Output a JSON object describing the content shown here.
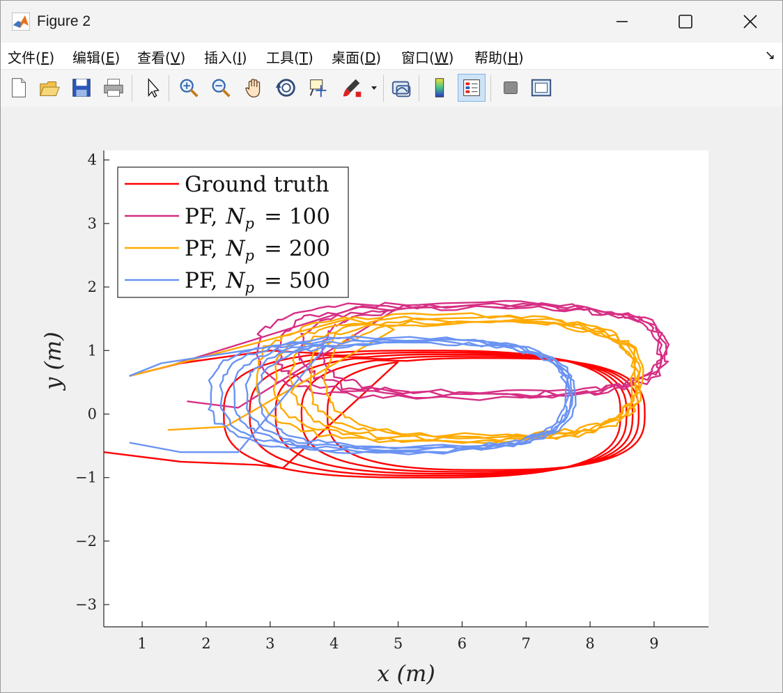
{
  "window": {
    "title": "Figure 2"
  },
  "menu": [
    {
      "pre": "文件(",
      "key": "F",
      "post": ")"
    },
    {
      "pre": "编辑(",
      "key": "E",
      "post": ")"
    },
    {
      "pre": "查看(",
      "key": "V",
      "post": ")"
    },
    {
      "pre": "插入(",
      "key": "I",
      "post": ")"
    },
    {
      "pre": "工具(",
      "key": "T",
      "post": ")"
    },
    {
      "pre": "桌面(",
      "key": "D",
      "post": ")"
    },
    {
      "pre": "窗口(",
      "key": "W",
      "post": ")"
    },
    {
      "pre": "帮助(",
      "key": "H",
      "post": ")"
    }
  ],
  "toolbar": {
    "icons": [
      "new-file-icon",
      "open-folder-icon",
      "save-icon",
      "print-icon",
      "pointer-icon",
      "zoom-in-icon",
      "zoom-out-icon",
      "pan-hand-icon",
      "rotate-3d-icon",
      "data-tips-icon",
      "brush-icon",
      "link-plot-icon",
      "colorbar-icon",
      "legend-icon",
      "hide-plot-tools-icon",
      "show-plot-tools-icon"
    ],
    "active": "legend-icon"
  },
  "chart_data": {
    "type": "line",
    "xlabel": "x (m)",
    "ylabel": "y (m)",
    "xlim": [
      0.4,
      9.85
    ],
    "ylim": [
      -3.35,
      4.15
    ],
    "xticks": [
      1,
      2,
      3,
      4,
      5,
      6,
      7,
      8,
      9
    ],
    "yticks": [
      -3,
      -2,
      -1,
      0,
      1,
      2,
      3,
      4
    ],
    "xtick_labels": [
      "1",
      "2",
      "3",
      "4",
      "5",
      "6",
      "7",
      "8",
      "9"
    ],
    "ytick_labels": [
      "−3",
      "−2",
      "−1",
      "0",
      "1",
      "2",
      "3",
      "4"
    ],
    "grid": false,
    "legend": {
      "position": "top-left",
      "entries": [
        {
          "label_main": "Ground truth",
          "label_var": "",
          "label_sub": "",
          "label_val": ""
        },
        {
          "label_main": "PF,",
          "label_var": "N",
          "label_sub": "p",
          "label_val": "= 100"
        },
        {
          "label_main": "PF,",
          "label_var": "N",
          "label_sub": "p",
          "label_val": "= 200"
        },
        {
          "label_main": "PF,",
          "label_var": "N",
          "label_sub": "p",
          "label_val": "= 500"
        }
      ]
    },
    "series": [
      {
        "name": "Ground truth",
        "color": "#ff0000",
        "loops": {
          "cx": 6.0,
          "cy": 0.0,
          "rx": 3.1,
          "ry": 1.0,
          "n": 5,
          "shift": 0.25,
          "shrink": 0.05,
          "noise": 0.0
        },
        "lead": [
          [
            0.4,
            -0.6
          ],
          [
            1.6,
            -0.75
          ],
          [
            2.8,
            -0.8
          ],
          [
            3.2,
            -0.85
          ]
        ],
        "start": [
          [
            0.8,
            0.6
          ],
          [
            1.6,
            0.8
          ],
          [
            3.0,
            1.0
          ]
        ]
      },
      {
        "name": "PF, Np = 100",
        "color": "#d62f84",
        "loops": {
          "cx": 6.3,
          "cy": 1.0,
          "rx": 3.2,
          "ry": 0.75,
          "n": 4,
          "shift": 0.15,
          "shrink": 0.06,
          "noise": 0.05
        },
        "lead": [
          [
            1.7,
            0.2
          ],
          [
            2.5,
            0.1
          ]
        ],
        "start": [
          [
            0.8,
            0.6
          ],
          [
            1.4,
            0.75
          ]
        ]
      },
      {
        "name": "PF, Np = 200",
        "color": "#ffaa00",
        "loops": {
          "cx": 6.1,
          "cy": 0.55,
          "rx": 3.0,
          "ry": 1.0,
          "n": 5,
          "shift": 0.12,
          "shrink": 0.05,
          "noise": 0.045
        },
        "lead": [
          [
            1.4,
            -0.25
          ],
          [
            2.3,
            -0.2
          ]
        ],
        "start": [
          [
            0.8,
            0.6
          ],
          [
            1.2,
            0.7
          ]
        ]
      },
      {
        "name": "PF, Np = 500",
        "color": "#6a93f3",
        "loops": {
          "cx": 5.1,
          "cy": 0.3,
          "rx": 2.85,
          "ry": 0.9,
          "n": 5,
          "shift": 0.08,
          "shrink": 0.04,
          "noise": 0.035
        },
        "lead": [
          [
            0.8,
            -0.45
          ],
          [
            1.6,
            -0.6
          ],
          [
            2.5,
            -0.6
          ]
        ],
        "start": [
          [
            0.8,
            0.6
          ],
          [
            1.3,
            0.8
          ]
        ]
      }
    ]
  }
}
